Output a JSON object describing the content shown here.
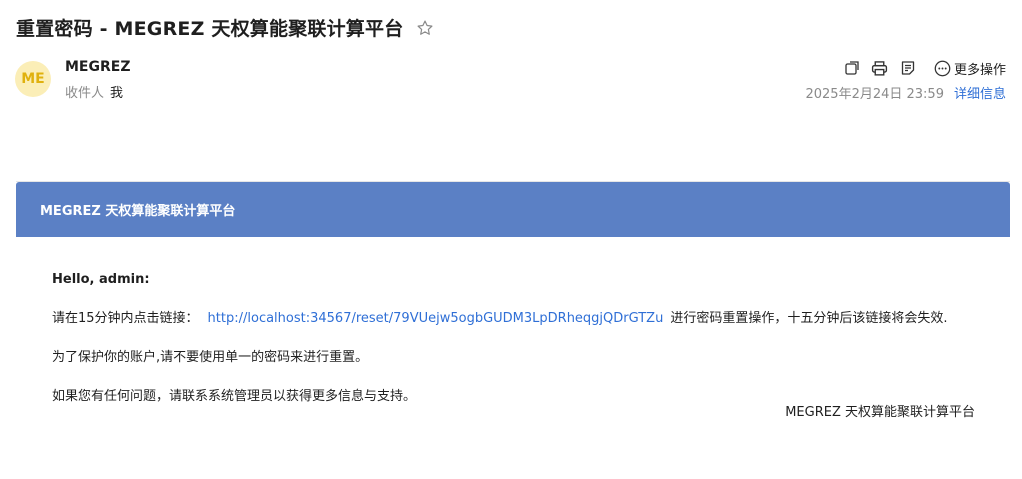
{
  "email": {
    "subject": "重置密码 - MEGREZ 天权算能聚联计算平台",
    "sender": {
      "avatar_initials": "ME",
      "name": "MEGREZ"
    },
    "recipient_label": "收件人",
    "recipient_value": "我",
    "date": "2025年2月24日 23:59",
    "details_link": "详细信息",
    "toolbar": {
      "more_actions": "更多操作",
      "icons": [
        "new-window-icon",
        "print-icon",
        "note-icon",
        "more-circle-icon"
      ]
    }
  },
  "body": {
    "banner_title": "MEGREZ 天权算能聚联计算平台",
    "greeting": "Hello, admin:",
    "para1_prefix": "请在15分钟内点击链接：",
    "reset_link": "http://localhost:34567/reset/79VUejw5ogbGUDM3LpDRheqgjQDrGTZu",
    "para1_suffix": "进行密码重置操作，十五分钟后该链接将会失效.",
    "para2": "为了保护你的账户,请不要使用单一的密码来进行重置。",
    "para3": "如果您有任何问题，请联系系统管理员以获得更多信息与支持。",
    "signature": "MEGREZ 天权算能聚联计算平台"
  },
  "colors": {
    "banner_bg": "#5b80c5",
    "link": "#2f6fd6",
    "avatar_bg": "#fbeeb7",
    "avatar_text": "#e0b10e"
  }
}
